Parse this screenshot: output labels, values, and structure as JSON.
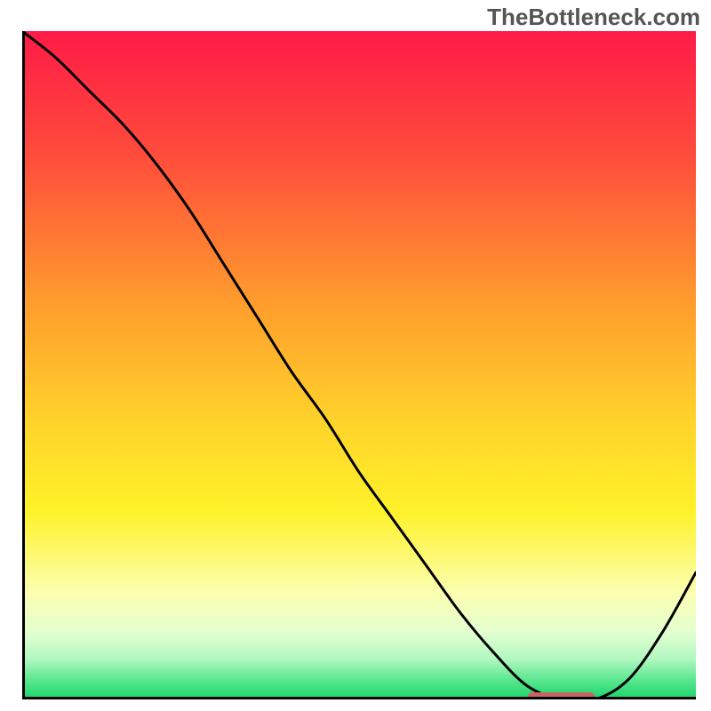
{
  "watermark": "TheBottleneck.com",
  "chart_data": {
    "type": "line",
    "title": "",
    "xlabel": "",
    "ylabel": "",
    "xlim": [
      0,
      100
    ],
    "ylim": [
      0,
      100
    ],
    "x": [
      0,
      5,
      10,
      15,
      20,
      25,
      30,
      35,
      40,
      45,
      50,
      55,
      60,
      65,
      70,
      75,
      80,
      85,
      90,
      95,
      100
    ],
    "values": [
      100,
      96,
      91,
      86,
      80,
      73,
      65,
      57,
      49,
      42,
      34,
      27,
      20,
      13,
      7,
      2,
      0,
      0,
      3,
      10,
      19
    ],
    "optimal_band": {
      "x_start": 75,
      "x_end": 85,
      "y": 0
    },
    "gradient_stops": [
      {
        "offset": 0.0,
        "color": "#ff1b47"
      },
      {
        "offset": 0.18,
        "color": "#ff4a3c"
      },
      {
        "offset": 0.4,
        "color": "#ff9a2d"
      },
      {
        "offset": 0.58,
        "color": "#ffd22a"
      },
      {
        "offset": 0.72,
        "color": "#fff22a"
      },
      {
        "offset": 0.84,
        "color": "#fbffb0"
      },
      {
        "offset": 0.9,
        "color": "#e3ffd0"
      },
      {
        "offset": 0.94,
        "color": "#b0f7c0"
      },
      {
        "offset": 0.97,
        "color": "#5ce890"
      },
      {
        "offset": 1.0,
        "color": "#19d46a"
      }
    ],
    "optimal_color": "#c96464",
    "line_color": "#000000",
    "axis_color": "#000000",
    "axis_width": 6,
    "line_width": 3
  }
}
